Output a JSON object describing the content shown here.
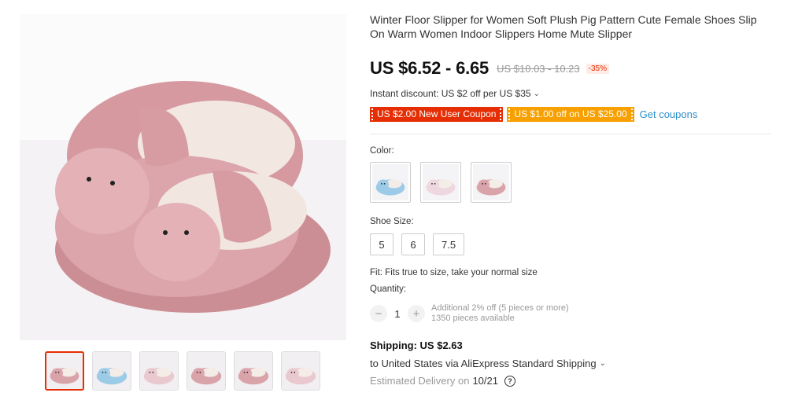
{
  "product": {
    "title": "Winter Floor Slipper for Women Soft Plush Pig Pattern Cute Female Shoes Slip On Warm Women Indoor Slippers Home Mute Slipper",
    "price": "US $6.52 - 6.65",
    "original_price": "US $10.03 - 10.23",
    "discount": "-35%"
  },
  "promotions": {
    "instant_discount": "Instant discount: US $2 off per US $35",
    "coupons": [
      "US $2.00 New User Coupon",
      "US $1.00 off on US $25.00"
    ],
    "get_coupons": "Get coupons"
  },
  "colors": {
    "label": "Color:",
    "options": [
      {
        "name": "blue",
        "hex": "#9ccbe8"
      },
      {
        "name": "white",
        "hex": "#eed7df"
      },
      {
        "name": "pink",
        "hex": "#d9a3aa"
      }
    ]
  },
  "sizes": {
    "label": "Shoe Size:",
    "options": [
      "5",
      "6",
      "7.5"
    ]
  },
  "fit": "Fit: Fits true to size, take your normal size",
  "quantity": {
    "label": "Quantity:",
    "value": "1",
    "minus": "−",
    "plus": "+",
    "additional": "Additional 2% off (5 pieces or more)",
    "available": "1350 pieces available"
  },
  "shipping": {
    "title": "Shipping: US $2.63",
    "to": "to United States via AliExpress Standard Shipping",
    "delivery_prefix": "Estimated Delivery on",
    "delivery_date": "10/21"
  },
  "gallery": {
    "thumb_count": 6,
    "active_index": 0,
    "colors": {
      "pink": "#d9a3aa",
      "light_pink": "#e9c9cf",
      "blue": "#9ccbe8",
      "bg": "#f1eff1"
    }
  },
  "icons": {
    "chevron": "chevron-down-icon",
    "help": "help-icon"
  }
}
